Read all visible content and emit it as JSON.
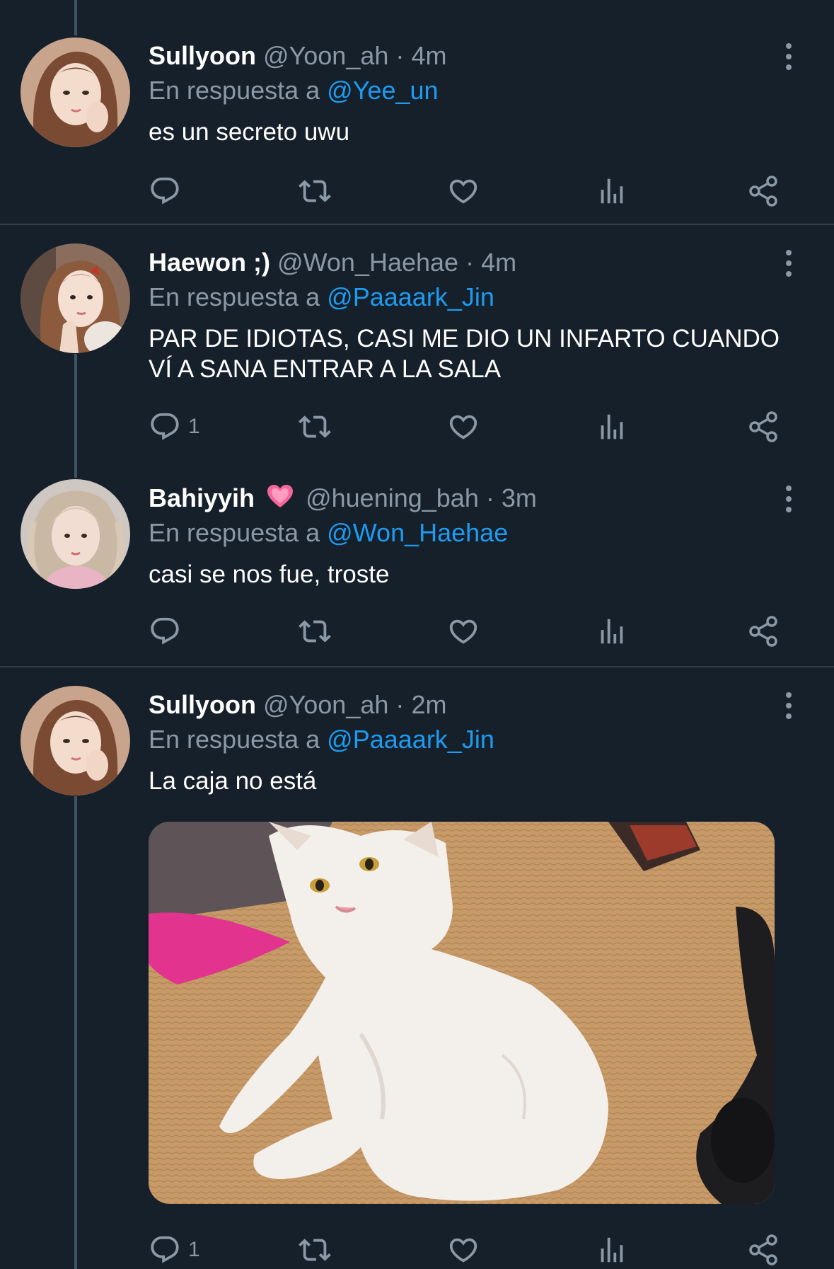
{
  "tweets": [
    {
      "display_name": "Sullyoon",
      "handle": "@Yoon_ah",
      "separator": "·",
      "time": "4m",
      "reply_prefix": "En respuesta a",
      "reply_to": "@Yee_un",
      "text": "es un secreto uwu",
      "reply_count": ""
    },
    {
      "display_name": "Haewon ;)",
      "handle": "@Won_Haehae",
      "separator": "·",
      "time": "4m",
      "reply_prefix": "En respuesta a",
      "reply_to": "@Paaaark_Jin",
      "text": "PAR DE IDIOTAS, CASI ME DIO UN INFARTO CUANDO VÍ A SANA ENTRAR A LA SALA",
      "reply_count": "1"
    },
    {
      "display_name": "Bahiyyih",
      "handle": "@huening_bah",
      "separator": "·",
      "time": "3m",
      "reply_prefix": "En respuesta a",
      "reply_to": "@Won_Haehae",
      "text": "casi se nos fue, troste",
      "reply_count": "",
      "name_emoji": "beating-heart-emoji"
    },
    {
      "display_name": "Sullyoon",
      "handle": "@Yoon_ah",
      "separator": "·",
      "time": "2m",
      "reply_prefix": "En respuesta a",
      "reply_to": "@Paaaark_Jin",
      "text": "La caja no está",
      "reply_count": "1",
      "media": "photo of a white cat standing on a carpet"
    }
  ],
  "icons": [
    "reply-icon",
    "retweet-icon",
    "like-icon",
    "views-icon",
    "share-icon",
    "more-options-icon"
  ],
  "colors": {
    "background": "#15202b",
    "secondary_text": "#8b98a5",
    "mention": "#1d9bf0",
    "divider": "#2f3b47",
    "thread_line": "#3d5466"
  }
}
